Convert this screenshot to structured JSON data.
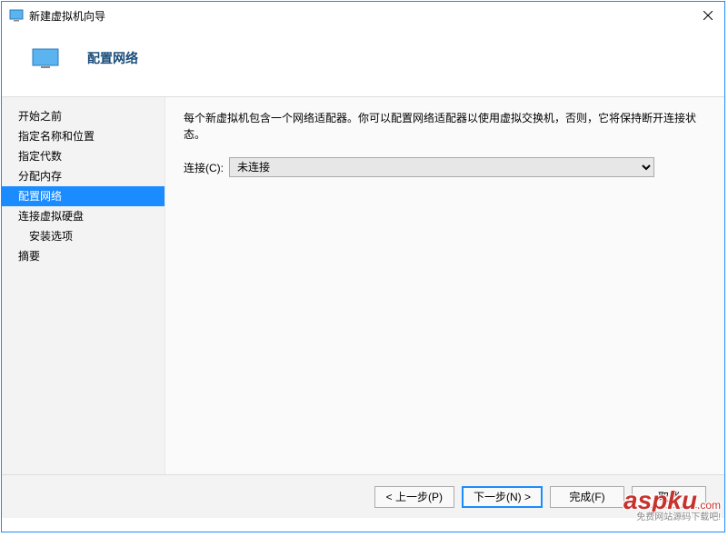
{
  "titlebar": {
    "title": "新建虚拟机向导"
  },
  "header": {
    "title": "配置网络"
  },
  "sidebar": {
    "items": [
      {
        "label": "开始之前",
        "active": false,
        "indent": false
      },
      {
        "label": "指定名称和位置",
        "active": false,
        "indent": false
      },
      {
        "label": "指定代数",
        "active": false,
        "indent": false
      },
      {
        "label": "分配内存",
        "active": false,
        "indent": false
      },
      {
        "label": "配置网络",
        "active": true,
        "indent": false
      },
      {
        "label": "连接虚拟硬盘",
        "active": false,
        "indent": false
      },
      {
        "label": "安装选项",
        "active": false,
        "indent": true
      },
      {
        "label": "摘要",
        "active": false,
        "indent": false
      }
    ]
  },
  "content": {
    "description": "每个新虚拟机包含一个网络适配器。你可以配置网络适配器以使用虚拟交换机，否则，它将保持断开连接状态。",
    "connection_label": "连接(C):",
    "connection_value": "未连接"
  },
  "footer": {
    "prev": "< 上一步(P)",
    "next": "下一步(N) >",
    "finish": "完成(F)",
    "cancel": "取消"
  },
  "watermark": {
    "main": "aspku",
    "dotcom": ".com",
    "sub": "免费网站源码下载吧!"
  }
}
